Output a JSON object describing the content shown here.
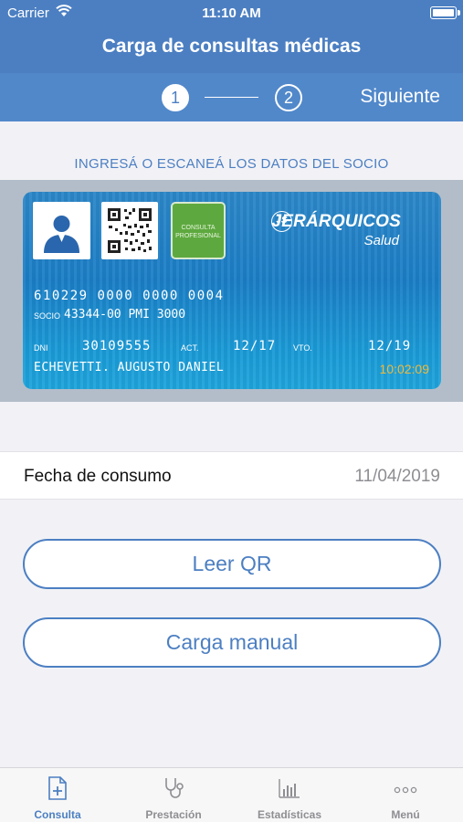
{
  "status_bar": {
    "carrier": "Carrier",
    "time": "11:10 AM",
    "icons": [
      "wifi-icon",
      "battery-icon"
    ]
  },
  "header": {
    "title": "Carga de consultas médicas"
  },
  "stepper": {
    "step1": "1",
    "step2": "2",
    "next_label": "Siguiente"
  },
  "instructions": "INGRESÁ O ESCANEÁ LOS DATOS DEL SOCIO",
  "card": {
    "badge_text": "CONSULTA PROFESIONAL",
    "brand_logo": "JS",
    "brand_name": "JERÁRQUICOS",
    "brand_sub": "Salud",
    "card_number": "610229 0000 0000 0004",
    "socio_label": "SOCIO",
    "socio_value": "43344-00 PMI 3000",
    "dni_label": "DNI",
    "dni_value": "30109555",
    "act_label": "ACT.",
    "act_value": "12/17",
    "vto_label": "VTO.",
    "vto_value": "12/19",
    "holder_name": "ECHEVETTI. AUGUSTO DANIEL",
    "clock": "10:02:09"
  },
  "consumption": {
    "label": "Fecha de consumo",
    "value": "11/04/2019"
  },
  "actions": {
    "read_qr": "Leer QR",
    "manual": "Carga manual"
  },
  "tabs": [
    {
      "label": "Consulta",
      "icon": "document-plus-icon",
      "active": true
    },
    {
      "label": "Prestación",
      "icon": "stethoscope-icon",
      "active": false
    },
    {
      "label": "Estadísticas",
      "icon": "bar-chart-icon",
      "active": false
    },
    {
      "label": "Menú",
      "icon": "more-icon",
      "active": false
    }
  ],
  "colors": {
    "primary": "#4c7fc2",
    "background": "#f2f2f6",
    "card_blue": "#1b7ec6",
    "badge_green": "#5ea93f",
    "clock_amber": "#f0b93a"
  }
}
